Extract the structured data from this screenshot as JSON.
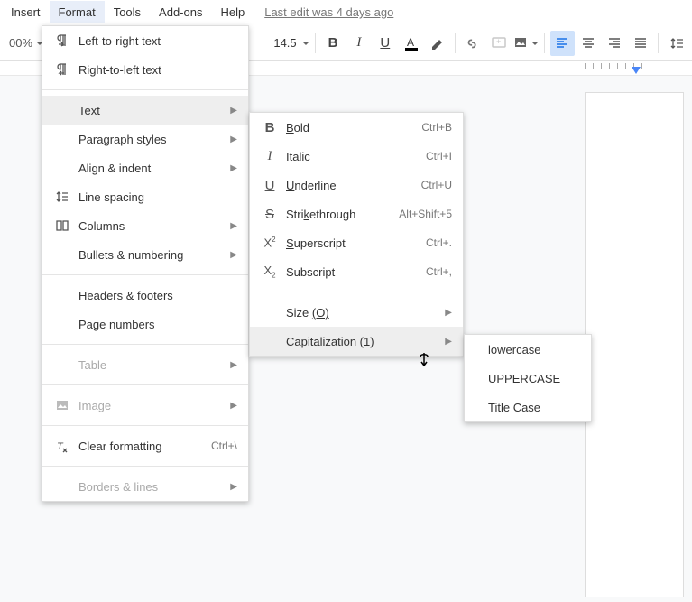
{
  "menubar": {
    "items": [
      "Insert",
      "Format",
      "Tools",
      "Add-ons",
      "Help"
    ],
    "active": "Format",
    "lastEdit": "Last edit was 4 days ago"
  },
  "toolbar": {
    "zoom": "00%",
    "fontSize": "14.5"
  },
  "formatMenu": {
    "ltr": "Left-to-right text",
    "rtl": "Right-to-left text",
    "text": "Text",
    "paragraph": "Paragraph styles",
    "align": "Align & indent",
    "lineSpacing": "Line spacing",
    "columns": "Columns",
    "bullets": "Bullets & numbering",
    "headers": "Headers & footers",
    "pageNumbers": "Page numbers",
    "table": "Table",
    "image": "Image",
    "clearFormatting": "Clear formatting",
    "clearFormattingKey": "Ctrl+\\",
    "borders": "Borders & lines"
  },
  "textMenu": {
    "bold": "Bold",
    "boldKey": "Ctrl+B",
    "italic": "Italic",
    "italicKey": "Ctrl+I",
    "underline": "Underline",
    "underlineKey": "Ctrl+U",
    "strike": "Strikethrough",
    "strikeKey": "Alt+Shift+5",
    "super": "Superscript",
    "superKey": "Ctrl+.",
    "sub": "Subscript",
    "subKey": "Ctrl+,",
    "size": "Size",
    "sizeHint": "(O)",
    "cap": "Capitalization",
    "capHint": "(1)"
  },
  "capMenu": {
    "lower": "lowercase",
    "upper": "UPPERCASE",
    "title": "Title Case"
  }
}
